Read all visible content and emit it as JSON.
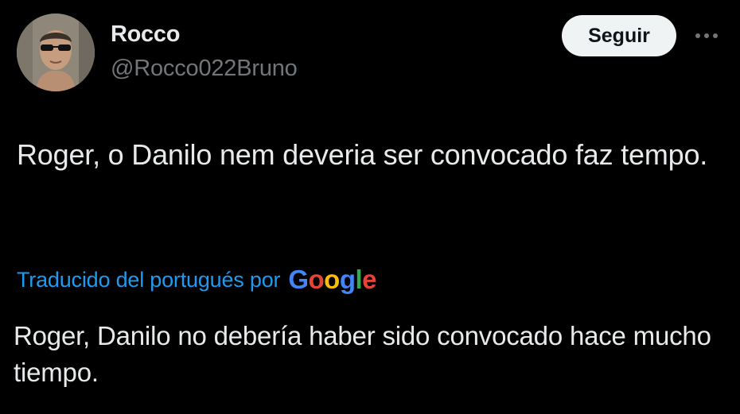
{
  "user": {
    "display_name": "Rocco",
    "handle": "@Rocco022Bruno",
    "avatar_icon": "user-photo"
  },
  "actions": {
    "follow_label": "Seguir",
    "more_icon": "more-horizontal-icon"
  },
  "tweet": {
    "text": "Roger, o Danilo nem deveria ser convocado faz tempo."
  },
  "translation": {
    "label": "Traducido del portugués por",
    "provider": "Google",
    "text": "Roger, Danilo no debería haber sido convocado hace mucho tiempo."
  },
  "colors": {
    "background": "#000000",
    "text_primary": "#e7e9ea",
    "text_secondary": "#71767b",
    "link": "#1d9bf0",
    "follow_button_bg": "#eff3f4",
    "google_blue": "#4285f4",
    "google_red": "#ea4335",
    "google_yellow": "#fbbc05",
    "google_green": "#34a853"
  }
}
